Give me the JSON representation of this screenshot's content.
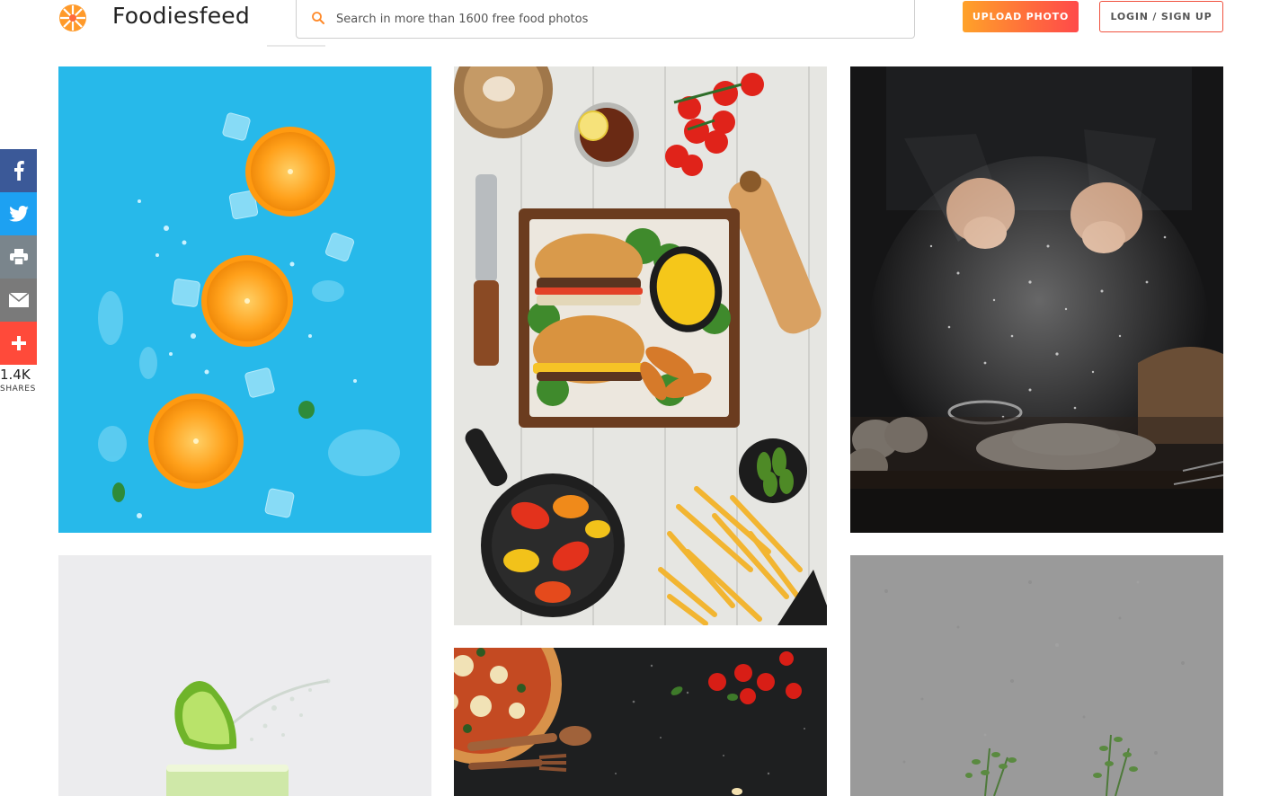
{
  "header": {
    "brand": "Foodiesfeed",
    "search_placeholder": "Search in more than 1600 free food photos",
    "upload_label": "UPLOAD PHOTO",
    "login_label": "LOGIN / SIGN UP"
  },
  "share": {
    "buttons": [
      "facebook-icon",
      "twitter-icon",
      "print-icon",
      "email-icon",
      "plus-icon"
    ],
    "count": "1.4K",
    "label": "SHARES"
  },
  "photos": [
    {
      "subject": "oranges",
      "icon": "orange-slices-photo"
    },
    {
      "subject": "burger-platter",
      "icon": "burger-platter-photo"
    },
    {
      "subject": "flour-hands",
      "icon": "flour-hands-photo"
    },
    {
      "subject": "lime-drink",
      "icon": "lime-drink-photo"
    },
    {
      "subject": "pizza",
      "icon": "pizza-photo"
    },
    {
      "subject": "herbs",
      "icon": "herbs-photo"
    }
  ],
  "colors": {
    "accent_orange": "#ff8a2a",
    "accent_red": "#f0523f",
    "facebook": "#3b5998",
    "twitter": "#1da1f2",
    "print": "#7a858c",
    "email": "#7a7a7a",
    "more": "#ff4a3a"
  }
}
